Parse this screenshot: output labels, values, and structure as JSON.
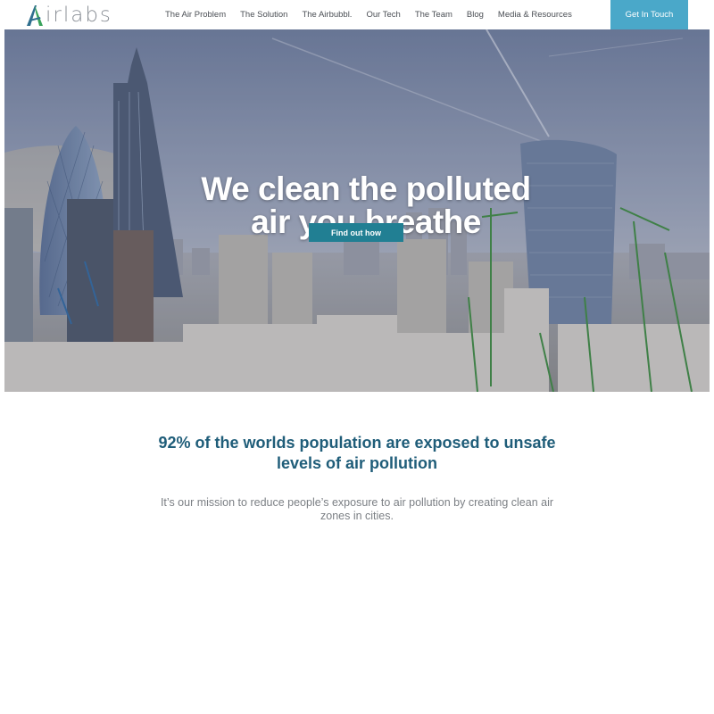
{
  "logo": {
    "text": "irlabs",
    "name": "Airlabs"
  },
  "nav": {
    "items": [
      {
        "label": "The Air Problem"
      },
      {
        "label": "The Solution"
      },
      {
        "label": "The Airbubbl."
      },
      {
        "label": "Our Tech"
      },
      {
        "label": "The Team"
      },
      {
        "label": "Blog"
      },
      {
        "label": "Media & Resources"
      }
    ],
    "cta_label": "Get In Touch"
  },
  "hero": {
    "title": "We clean the polluted\nair you breathe",
    "button_label": "Find out how"
  },
  "content": {
    "headline": "92% of the worlds population are exposed to unsafe levels of air pollution",
    "mission": "It’s our mission to reduce people’s exposure to air pollution by creating clean air zones in cities."
  },
  "colors": {
    "brand_blue": "#1f5d79",
    "cta_blue": "#4aa8c9",
    "button_teal": "#217f93",
    "logo_green": "#3aa35c"
  }
}
